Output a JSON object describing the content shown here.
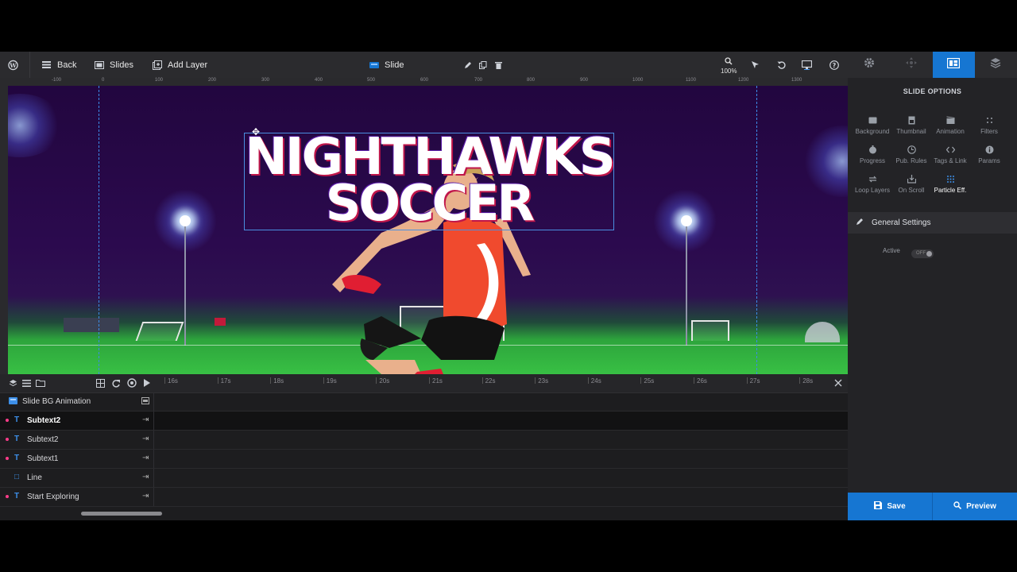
{
  "toolbar": {
    "back_label": "Back",
    "slides_label": "Slides",
    "add_layer_label": "Add Layer",
    "slide_label": "Slide",
    "zoom_level": "100%"
  },
  "ruler": {
    "marks": [
      "-100",
      "0",
      "100",
      "200",
      "300",
      "400",
      "500",
      "600",
      "700",
      "800",
      "900",
      "1000",
      "1100",
      "1200",
      "1300"
    ]
  },
  "stage": {
    "title_line1": "NIGHTHAWKS",
    "title_line2": "SOCCER"
  },
  "timeline": {
    "ticks": [
      "16s",
      "17s",
      "18s",
      "19s",
      "20s",
      "21s",
      "22s",
      "23s",
      "24s",
      "25s",
      "26s",
      "27s",
      "28s"
    ],
    "bg_animation_label": "Slide BG Animation",
    "layers": [
      {
        "type": "T",
        "label": "Subtext2",
        "selected": true
      },
      {
        "type": "T",
        "label": "Subtext2",
        "selected": false
      },
      {
        "type": "T",
        "label": "Subtext1",
        "selected": false
      },
      {
        "type": "□",
        "label": "Line",
        "selected": false
      },
      {
        "type": "T",
        "label": "Start Exploring",
        "selected": false
      }
    ]
  },
  "panel": {
    "title": "SLIDE OPTIONS",
    "options": [
      {
        "label": "Background",
        "icon": "image-icon"
      },
      {
        "label": "Thumbnail",
        "icon": "thumbnail-icon"
      },
      {
        "label": "Animation",
        "icon": "film-icon"
      },
      {
        "label": "Filters",
        "icon": "filters-icon"
      },
      {
        "label": "Progress",
        "icon": "stopwatch-icon"
      },
      {
        "label": "Pub. Rules",
        "icon": "clock-icon"
      },
      {
        "label": "Tags & Link",
        "icon": "code-icon"
      },
      {
        "label": "Params",
        "icon": "info-icon"
      },
      {
        "label": "Loop Layers",
        "icon": "loop-icon"
      },
      {
        "label": "On Scroll",
        "icon": "scroll-icon"
      },
      {
        "label": "Particle Eff.",
        "icon": "particles-icon"
      }
    ],
    "general_settings_label": "General Settings",
    "active_label": "Active",
    "switch_label": "OFF",
    "save_label": "Save",
    "preview_label": "Preview"
  },
  "colors": {
    "accent": "#1676d2",
    "layer_dot": "#ff3c8a",
    "stage_sky": "#2b0a4e",
    "field_green": "#38c044"
  }
}
